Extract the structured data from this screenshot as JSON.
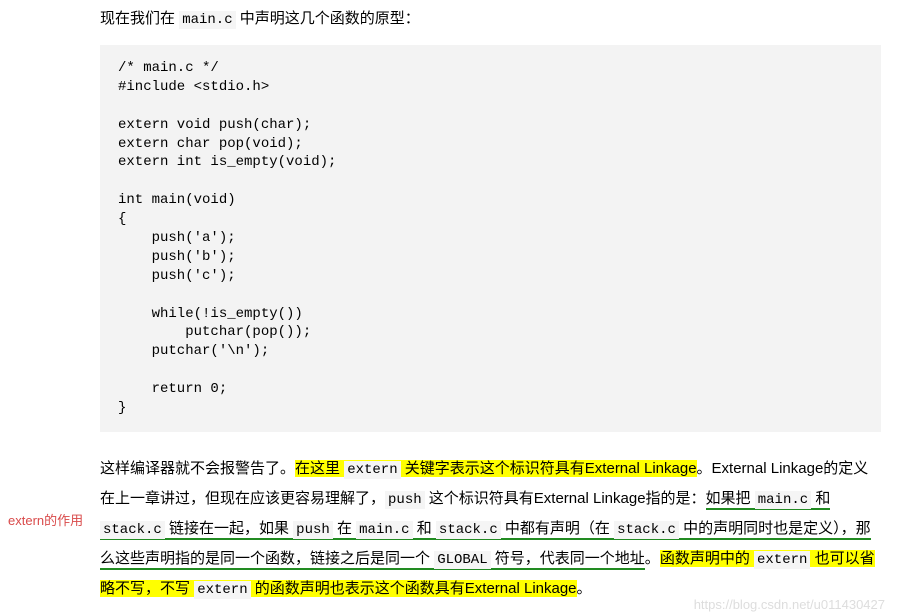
{
  "intro": {
    "before": "现在我们在",
    "code": "main.c",
    "after": "中声明这几个函数的原型："
  },
  "code_block": "/* main.c */\n#include <stdio.h>\n\nextern void push(char);\nextern char pop(void);\nextern int is_empty(void);\n\nint main(void)\n{\n    push('a');\n    push('b');\n    push('c');\n\n    while(!is_empty())\n        putchar(pop());\n    putchar('\\n');\n\n    return 0;\n}",
  "sidebar_note": "extern的作用",
  "para": {
    "t1": "这样编译器就不会报警告了。",
    "hl1_a": "在这里",
    "hl1_code": "extern",
    "hl1_b": "关键字表示这个标识符具有External Linkage",
    "t2": "。External Linkage的定义在上一章讲过，但现在应该更容易理解了，",
    "code_push1": "push",
    "t3": " 这个标识符具有External Linkage指的是：",
    "ul_a": "如果把",
    "ul_code1": "main.c",
    "ul_b": "和",
    "ul_code2": "stack.c",
    "ul_c": "链接在一起，如果",
    "ul_code3": "push",
    "ul_d": "在",
    "ul_code4": "main.c",
    "ul_e": "和",
    "ul_code5": "stack.c",
    "ul_f": "中都有声明（在",
    "ul_code6": "stack.c",
    "ul_g": "中的声明同时也是定义），那么这些声明指的是同一个函数，链接之后是同一个",
    "ul_code7": "GLOBAL",
    "ul_h": "符号，代表同一个地址",
    "t4": "。",
    "hl2_a": "函数声明中的",
    "hl2_code1": "extern",
    "hl2_b": "也可以省略不写，不写",
    "hl2_code2": "extern",
    "hl2_c": "的函数声明也表示这个函数具有External Linkage",
    "t5": "。"
  },
  "watermark": "https://blog.csdn.net/u011430427"
}
